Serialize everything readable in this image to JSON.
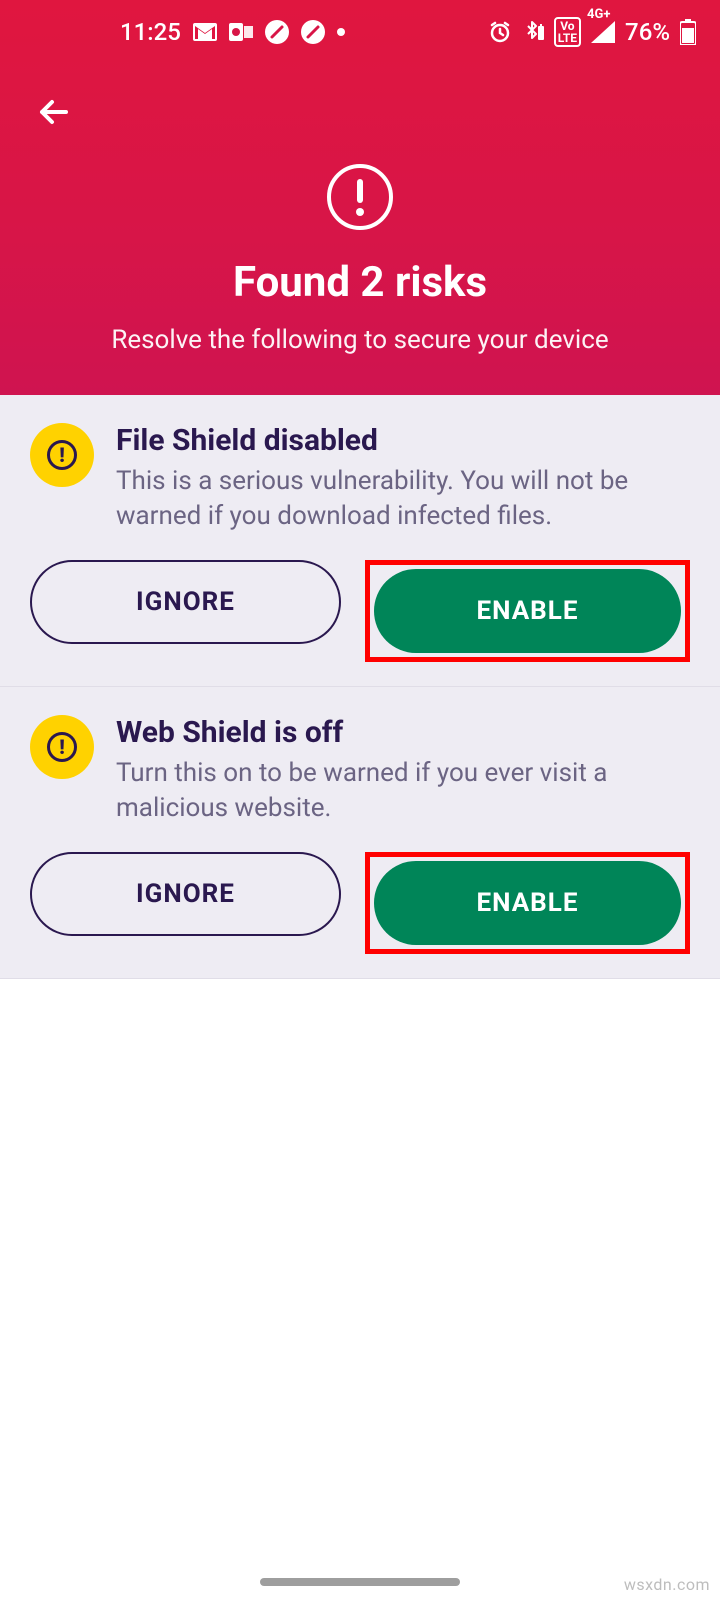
{
  "status": {
    "time": "11:25",
    "battery": "76%",
    "signal_label": "4G+",
    "volte": "Vo\nLTE"
  },
  "header": {
    "title": "Found 2 risks",
    "subtitle": "Resolve the following to secure your device"
  },
  "risks": [
    {
      "title": "File Shield disabled",
      "desc": "This is a serious vulnerability. You will not be warned if you download infected files.",
      "ignore_label": "IGNORE",
      "enable_label": "ENABLE"
    },
    {
      "title": "Web Shield is off",
      "desc": "Turn this on to be warned if you ever visit a malicious website.",
      "ignore_label": "IGNORE",
      "enable_label": "ENABLE"
    }
  ],
  "watermark": "wsxdn.com"
}
